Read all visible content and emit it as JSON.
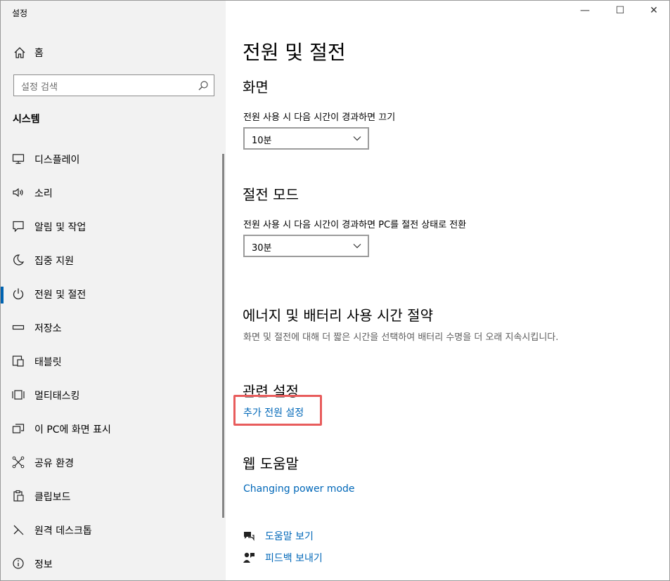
{
  "window": {
    "title": "설정",
    "minimize": "—",
    "maximize": "☐",
    "close": "✕"
  },
  "sidebar": {
    "home_label": "홈",
    "search_placeholder": "설정 검색",
    "section_title": "시스템",
    "items": [
      {
        "label": "디스플레이",
        "icon": "monitor-icon"
      },
      {
        "label": "소리",
        "icon": "speaker-icon"
      },
      {
        "label": "알림 및 작업",
        "icon": "notification-icon"
      },
      {
        "label": "집중 지원",
        "icon": "moon-icon"
      },
      {
        "label": "전원 및 절전",
        "icon": "power-icon",
        "active": true
      },
      {
        "label": "저장소",
        "icon": "storage-icon"
      },
      {
        "label": "태블릿",
        "icon": "tablet-icon"
      },
      {
        "label": "멀티태스킹",
        "icon": "multitasking-icon"
      },
      {
        "label": "이 PC에 화면 표시",
        "icon": "project-icon"
      },
      {
        "label": "공유 환경",
        "icon": "shared-icon"
      },
      {
        "label": "클립보드",
        "icon": "clipboard-icon"
      },
      {
        "label": "원격 데스크톱",
        "icon": "remote-desktop-icon"
      },
      {
        "label": "정보",
        "icon": "info-icon"
      }
    ]
  },
  "main": {
    "page_title": "전원 및 절전",
    "screen": {
      "heading": "화면",
      "label": "전원 사용 시 다음 시간이 경과하면 끄기",
      "value": "10분"
    },
    "sleep": {
      "heading": "절전 모드",
      "label": "전원 사용 시 다음 시간이 경과하면 PC를 절전 상태로 전환",
      "value": "30분"
    },
    "energy": {
      "heading": "에너지 및 배터리 사용 시간 절약",
      "desc": "화면 및 절전에 대해 더 짧은 시간을 선택하여 배터리 수명을 더 오래 지속시킵니다."
    },
    "related": {
      "heading": "관련 설정",
      "link": "추가 전원 설정"
    },
    "web_help": {
      "heading": "웹 도움말",
      "link": "Changing power mode"
    },
    "help": {
      "get_help": "도움말 보기",
      "feedback": "피드백 보내기"
    }
  },
  "colors": {
    "accent": "#0067b8",
    "active_bar": "#0063b1",
    "highlight": "#e85c5c",
    "sidebar_bg": "#f2f2f2"
  }
}
